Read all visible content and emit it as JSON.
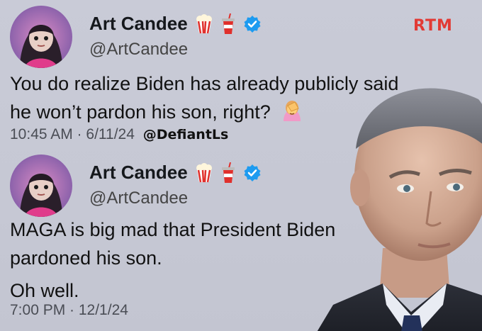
{
  "watermark": "RTM",
  "tweet1": {
    "name": "Art Candee",
    "handle": "@ArtCandee",
    "lines": [
      "You do realize Biden has already publicly said",
      "he won’t pardon his son, right?"
    ],
    "time": "10:45 AM · 6/11/24",
    "credit": "@DefiantLs"
  },
  "tweet2": {
    "name": "Art Candee",
    "handle": "@ArtCandee",
    "lines": [
      "MAGA is big mad that President Biden",
      "pardoned his son.",
      "Oh well."
    ],
    "time": "7:00 PM · 12/1/24"
  },
  "icons": {
    "popcorn": "popcorn-icon",
    "drink": "soda-cup-icon",
    "verified": "verified-badge-icon",
    "facepalm": "facepalm-emoji-icon"
  },
  "colors": {
    "background": "#c8cad6",
    "watermark": "#e23a35",
    "verified": "#1d9bf0"
  }
}
